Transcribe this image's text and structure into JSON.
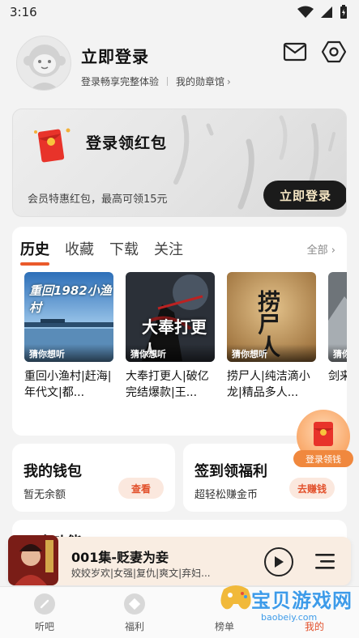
{
  "status_bar": {
    "time": "3:16"
  },
  "profile": {
    "title": "立即登录",
    "subtitle": "登录畅享完整体验",
    "badge_link": "我的勋章馆",
    "icons": [
      "mail-icon",
      "settings-hexagon-icon"
    ]
  },
  "banner": {
    "title": "登录领红包",
    "description": "会员特惠红包，最高可领15元",
    "button": "立即登录",
    "accent": "#1b1b1b"
  },
  "history": {
    "tabs": [
      "历史",
      "收藏",
      "下载",
      "关注"
    ],
    "active_tab": "历史",
    "all_label": "全部",
    "accent": "#ea5a2b",
    "books": [
      {
        "tag": "猜你想听",
        "cover_text": "重回1982小渔村",
        "title": "重回小渔村|赶海|年代文|都..."
      },
      {
        "tag": "猜你想听",
        "cover_text": "大奉打更人",
        "title": "大奉打更人|破亿完结爆款|王..."
      },
      {
        "tag": "猜你想听",
        "cover_text": "捞尸人",
        "title": "捞尸人|纯洁滴小龙|精品多人..."
      },
      {
        "tag": "猜你",
        "cover_text": "",
        "title": "剑来有声"
      }
    ]
  },
  "wallet": {
    "title": "我的钱包",
    "subtitle": "暂无余额",
    "button": "查看"
  },
  "signin": {
    "title": "签到领福利",
    "subtitle": "超轻松赚金币",
    "button": "去赚钱"
  },
  "float_gift": {
    "label": "登录领钱"
  },
  "partial_section": {
    "title": "更多功能"
  },
  "player": {
    "title": "001集-贬妻为妾",
    "subtitle": "姣姣岁欢|女强|复仇|爽文|弃妇..."
  },
  "bottom_nav": [
    {
      "label": "听吧",
      "icon": "listen-icon",
      "active": false
    },
    {
      "label": "福利",
      "icon": "gift-icon",
      "active": false
    },
    {
      "label": "榜单",
      "icon": "rank-icon",
      "active": false
    },
    {
      "label": "我的",
      "icon": "profile-icon",
      "active": true
    }
  ],
  "watermark": {
    "text": "宝贝游戏网",
    "url": "baobeiy.com"
  }
}
